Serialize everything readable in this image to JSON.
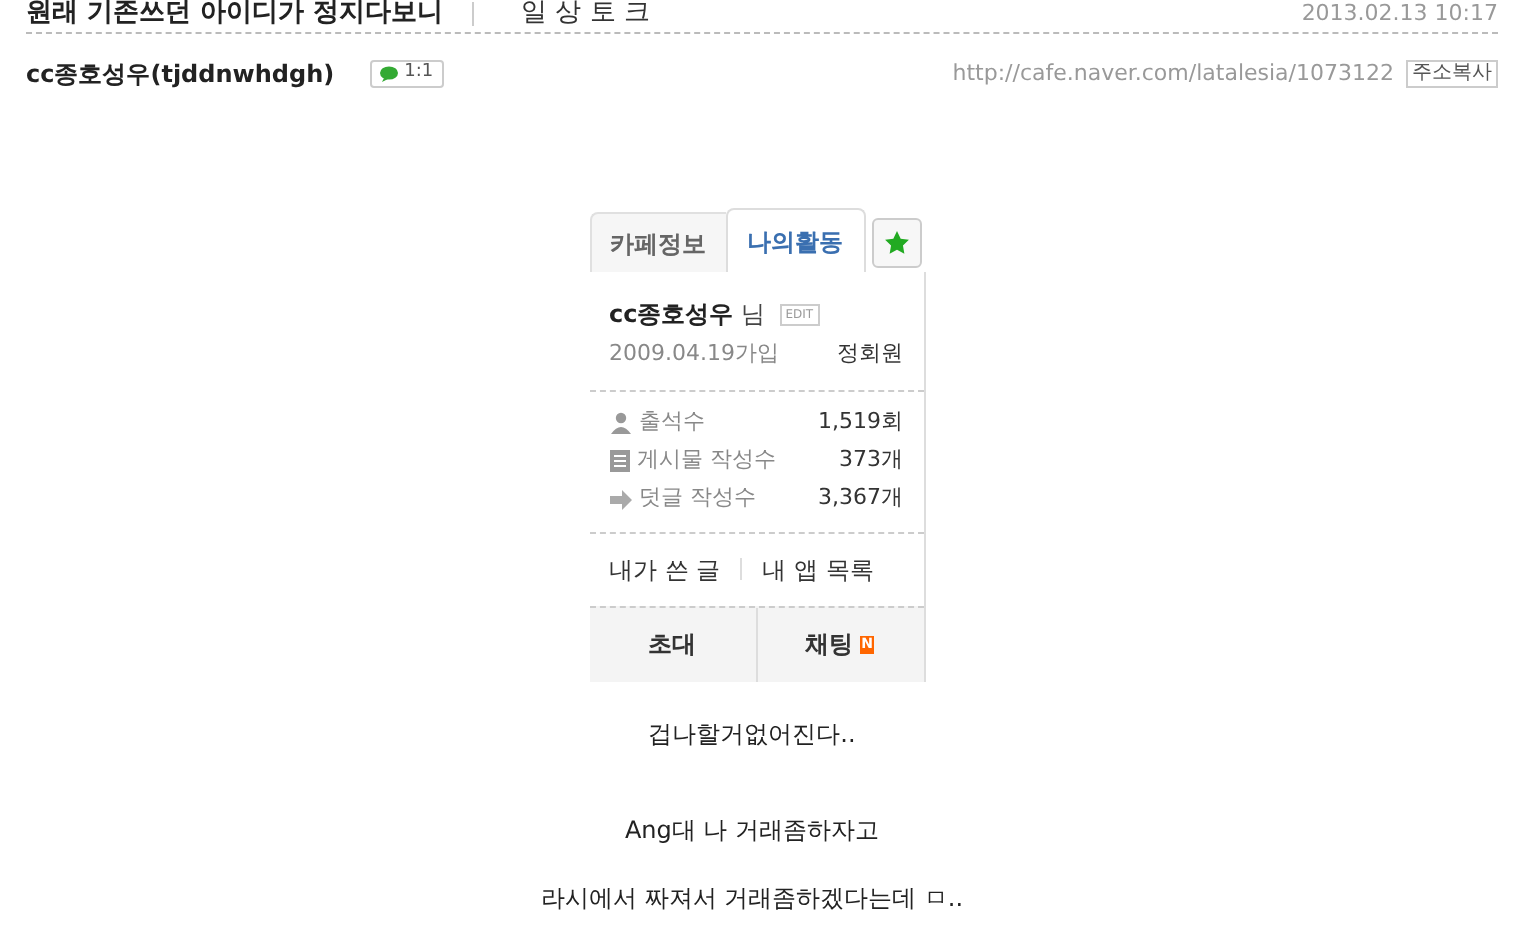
{
  "post": {
    "title": "원래 기존쓰던 아이디가 정지다보니",
    "category": "일 상 토 크",
    "date": "2013.02.13 10:17",
    "author": "cc종호성우(tjddnwhdgh)",
    "chat_badge": "1:1",
    "url": "http://cafe.naver.com/latalesia/1073122",
    "copy_button": "주소복사"
  },
  "card": {
    "tabs": [
      {
        "label": "카페정보",
        "selected": false
      },
      {
        "label": "나의활동",
        "selected": true
      }
    ],
    "name": "cc종호성우",
    "suffix": "님",
    "edit": "EDIT",
    "joined": "2009.04.19가입",
    "rank": "정회원",
    "stats": [
      {
        "kind": "person",
        "label": "출석수",
        "value": "1,519회"
      },
      {
        "kind": "document",
        "label": "게시물 작성수",
        "value": "373개"
      },
      {
        "kind": "arrow",
        "label": "덧글 작성수",
        "value": "3,367개"
      }
    ],
    "links": [
      "내가 쓴 글",
      "내 앱 목록"
    ],
    "buttons": [
      {
        "label": "초대",
        "new": false
      },
      {
        "label": "채팅",
        "new": true,
        "new_badge": "N"
      }
    ]
  },
  "body": [
    "겁나할거없어진다..",
    "Ang대 나 거래좀하자고",
    "라시에서 짜져서 거래좀하겠다는데 ㅁ.."
  ]
}
